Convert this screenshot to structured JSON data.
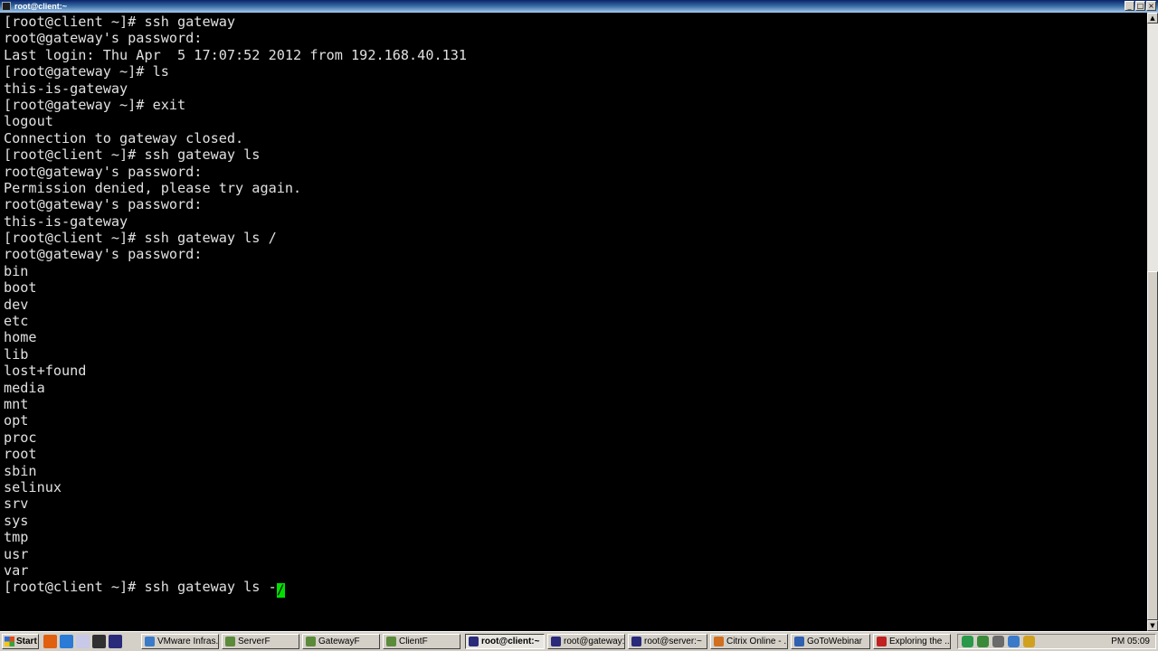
{
  "window": {
    "title": "root@client:~",
    "controls": {
      "minimize": "_",
      "maximize": "□",
      "close": "×"
    }
  },
  "terminal": {
    "lines": [
      "[root@client ~]# ssh gateway",
      "root@gateway's password:",
      "Last login: Thu Apr  5 17:07:52 2012 from 192.168.40.131",
      "[root@gateway ~]# ls",
      "this-is-gateway",
      "[root@gateway ~]# exit",
      "logout",
      "Connection to gateway closed.",
      "[root@client ~]# ssh gateway ls",
      "root@gateway's password:",
      "Permission denied, please try again.",
      "root@gateway's password:",
      "this-is-gateway",
      "[root@client ~]# ssh gateway ls /",
      "root@gateway's password:",
      "bin",
      "boot",
      "dev",
      "etc",
      "home",
      "lib",
      "lost+found",
      "media",
      "mnt",
      "opt",
      "proc",
      "root",
      "sbin",
      "selinux",
      "srv",
      "sys",
      "tmp",
      "usr",
      "var"
    ],
    "prompt_line": "[root@client ~]# ssh gateway ls -",
    "cursor_char": "/",
    "cursor_color": "#00e000"
  },
  "scrollbar": {
    "up": "▲",
    "down": "▼"
  },
  "taskbar": {
    "start_label": "Start",
    "quick_launch": [
      "firefox-icon",
      "ie-icon",
      "show-desktop-icon",
      "cmd-icon",
      "putty-icon"
    ],
    "tasks": [
      {
        "label": "VMware Infras...",
        "icon": "vmware-icon",
        "color": "#3a7ac8",
        "active": false
      },
      {
        "label": "ServerF",
        "icon": "vm-icon",
        "color": "#5a8a3a",
        "active": false
      },
      {
        "label": "GatewayF",
        "icon": "vm-icon",
        "color": "#5a8a3a",
        "active": false
      },
      {
        "label": "ClientF",
        "icon": "vm-icon",
        "color": "#5a8a3a",
        "active": false
      },
      {
        "label": "root@client:~",
        "icon": "putty-icon",
        "color": "#2a2a7a",
        "active": true
      },
      {
        "label": "root@gateway:~",
        "icon": "putty-icon",
        "color": "#2a2a7a",
        "active": false
      },
      {
        "label": "root@server:~",
        "icon": "putty-icon",
        "color": "#2a2a7a",
        "active": false
      },
      {
        "label": "Citrix Online - ...",
        "icon": "citrix-icon",
        "color": "#d07020",
        "active": false
      },
      {
        "label": "GoToWebinar",
        "icon": "gotowebinar-icon",
        "color": "#3060b0",
        "active": false
      },
      {
        "label": "Exploring the ...",
        "icon": "pdf-icon",
        "color": "#c02020",
        "active": false
      }
    ],
    "tray_icons": [
      "network-icon",
      "security-icon",
      "volume-icon",
      "vmware-tray-icon",
      "update-icon"
    ],
    "clock": "PM 05:09"
  }
}
